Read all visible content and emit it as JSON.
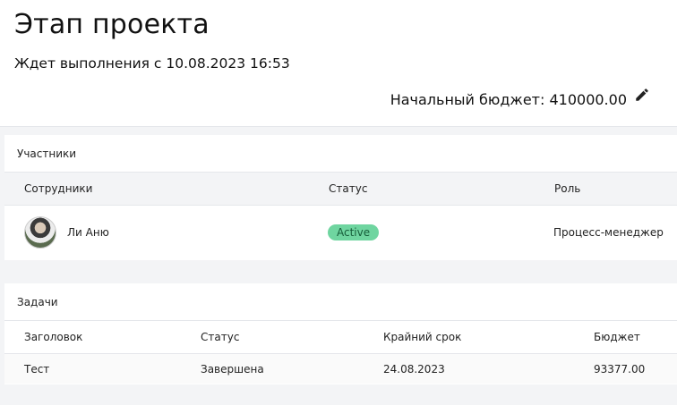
{
  "header": {
    "title": "Этап проекта",
    "subtitle": "Ждет выполнения с 10.08.2023 16:53",
    "budget_label": "Начальный бюджет: 410000.00",
    "edit_icon": "pencil-icon"
  },
  "participants": {
    "title": "Участники",
    "columns": [
      "Сотрудники",
      "Статус",
      "Роль"
    ],
    "rows": [
      {
        "name": "Ли Аню",
        "status": "Active",
        "role": "Процесс-менеджер",
        "avatar_icon": "user-avatar"
      }
    ]
  },
  "tasks": {
    "title": "Задачи",
    "columns": [
      "Заголовок",
      "Статус",
      "Крайний срок",
      "Бюджет"
    ],
    "rows": [
      {
        "title": "Тест",
        "status": "Завершена",
        "deadline": "24.08.2023",
        "budget": "93377.00"
      }
    ]
  },
  "colors": {
    "badge_bg": "#6fd5a0",
    "badge_text": "#165d3a",
    "page_bg": "#f3f4f6"
  }
}
